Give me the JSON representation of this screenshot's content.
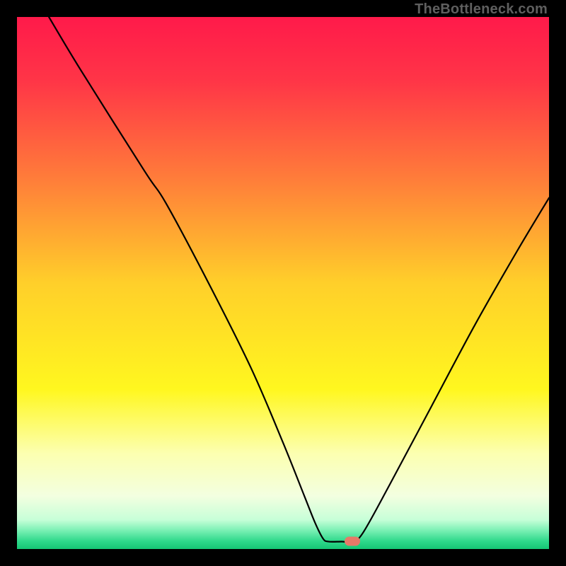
{
  "watermark": {
    "text": "TheBottleneck.com"
  },
  "chart_data": {
    "type": "line",
    "title": "",
    "xlabel": "",
    "ylabel": "",
    "xlim": [
      0,
      100
    ],
    "ylim": [
      0,
      100
    ],
    "grid": false,
    "legend": false,
    "background_gradient": {
      "stops": [
        {
          "pos": 0.0,
          "color": "#ff1a4a"
        },
        {
          "pos": 0.12,
          "color": "#ff3547"
        },
        {
          "pos": 0.3,
          "color": "#ff7b3a"
        },
        {
          "pos": 0.5,
          "color": "#ffcf2a"
        },
        {
          "pos": 0.7,
          "color": "#fff71f"
        },
        {
          "pos": 0.82,
          "color": "#fcffb0"
        },
        {
          "pos": 0.9,
          "color": "#f3ffe0"
        },
        {
          "pos": 0.945,
          "color": "#c7ffd8"
        },
        {
          "pos": 0.965,
          "color": "#7af0b4"
        },
        {
          "pos": 0.985,
          "color": "#2fd98b"
        },
        {
          "pos": 1.0,
          "color": "#15c574"
        }
      ]
    },
    "series": [
      {
        "name": "bottleneck-curve",
        "stroke": "#000000",
        "stroke_width": 2.2,
        "points": [
          {
            "x": 6.0,
            "y": 100.0
          },
          {
            "x": 12.0,
            "y": 90.0
          },
          {
            "x": 24.0,
            "y": 71.0
          },
          {
            "x": 28.0,
            "y": 65.0
          },
          {
            "x": 36.0,
            "y": 50.0
          },
          {
            "x": 44.0,
            "y": 34.0
          },
          {
            "x": 50.0,
            "y": 20.0
          },
          {
            "x": 54.0,
            "y": 10.0
          },
          {
            "x": 56.0,
            "y": 5.0
          },
          {
            "x": 57.5,
            "y": 2.0
          },
          {
            "x": 58.5,
            "y": 1.4
          },
          {
            "x": 61.0,
            "y": 1.4
          },
          {
            "x": 63.0,
            "y": 1.4
          },
          {
            "x": 65.0,
            "y": 3.0
          },
          {
            "x": 70.0,
            "y": 12.0
          },
          {
            "x": 78.0,
            "y": 27.0
          },
          {
            "x": 86.0,
            "y": 42.0
          },
          {
            "x": 94.0,
            "y": 56.0
          },
          {
            "x": 100.0,
            "y": 66.0
          }
        ]
      }
    ],
    "marker": {
      "name": "selected-point",
      "x": 63.0,
      "y": 1.4,
      "color": "#e77968"
    }
  }
}
